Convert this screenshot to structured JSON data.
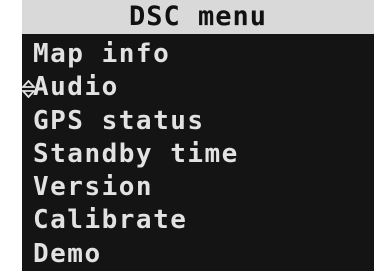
{
  "menu": {
    "title": "DSC menu",
    "selected_index": 1,
    "items": [
      {
        "label": "Map info"
      },
      {
        "label": "Audio"
      },
      {
        "label": "GPS status"
      },
      {
        "label": "Standby time"
      },
      {
        "label": "Version"
      },
      {
        "label": "Calibrate"
      },
      {
        "label": "Demo"
      }
    ]
  },
  "colors": {
    "screen_bg": "#141414",
    "title_bg": "#d9d9d9",
    "title_text": "#111111",
    "item_text": "#e2e2e2"
  },
  "icons": {
    "selection_marker": "up-down-arrow-icon"
  }
}
